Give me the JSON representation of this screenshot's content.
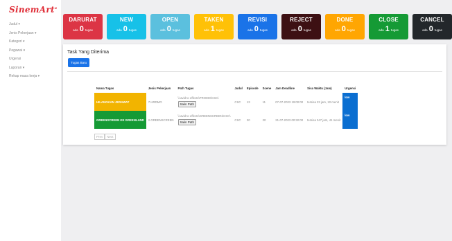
{
  "app": {
    "logo_text": "SinemArt",
    "logo_suffix": "a"
  },
  "sidebar": {
    "items": [
      {
        "label": "Judul ▾"
      },
      {
        "label": "Jenis Pekerjaan ▾"
      },
      {
        "label": "Kategori ▾"
      },
      {
        "label": "Pegawai ▾"
      },
      {
        "label": "Urgensi"
      },
      {
        "label": "Laporan ▾"
      },
      {
        "label": "Rekap masa kerja ▾"
      }
    ]
  },
  "cards": [
    {
      "title": "DARURAT",
      "prefix": "ada",
      "count": "0",
      "suffix": "tugas",
      "color": "#dc3545"
    },
    {
      "title": "NEW",
      "prefix": "ada",
      "count": "0",
      "suffix": "tugas",
      "color": "#17c1e8"
    },
    {
      "title": "OPEN",
      "prefix": "ada",
      "count": "0",
      "suffix": "tugas",
      "color": "#5bc0de"
    },
    {
      "title": "TAKEN",
      "prefix": "ada",
      "count": "1",
      "suffix": "tugas",
      "color": "#ffc107"
    },
    {
      "title": "REVISI",
      "prefix": "ada",
      "count": "0",
      "suffix": "tugas",
      "color": "#1a73e8"
    },
    {
      "title": "REJECT",
      "prefix": "ada",
      "count": "0",
      "suffix": "tugas",
      "color": "#3d1013"
    },
    {
      "title": "DONE",
      "prefix": "ada",
      "count": "0",
      "suffix": "tugas",
      "color": "#ffa602"
    },
    {
      "title": "CLOSE",
      "prefix": "ada",
      "count": "1",
      "suffix": "tugas",
      "color": "#159a35"
    },
    {
      "title": "CANCEL",
      "prefix": "ada",
      "count": "0",
      "suffix": "tugas",
      "color": "#23272b"
    }
  ],
  "panel": {
    "title": "Task Yang Diterima",
    "new_task_button": "Tugas Baru"
  },
  "table": {
    "headers": [
      "Nama Tugas",
      "Jenis Pekerjaan",
      "Path Tugas",
      "Judul",
      "Episode",
      "Scene",
      "Jam Deadline",
      "Sisa Waktu (Jam)",
      "Urgensi"
    ],
    "copy_button": "Salin Path",
    "rows": [
      {
        "name": "HILANGKAN JERAWAT",
        "name_color": "#f2b400",
        "jenis": "7.HRDMO",
        "path": "\\\\.avid to effects\\PROMO\\CSC\\",
        "judul": "CSC",
        "episode": "13",
        "scene": "11",
        "deadline": "07-07-2023 19:00:00",
        "sisa": "tersisa 23 jam, 10 menit",
        "urgensi": "low",
        "urgensi_color": "#0a6ed1"
      },
      {
        "name": "GREENSCREEN KE GREENLAND",
        "name_color": "#159a35",
        "jenis": "2.GREENSCREEN",
        "path": "\\\\.avid to effects\\GREENSCREEN\\CSC\\",
        "judul": "CSC",
        "episode": "20",
        "scene": "20",
        "deadline": "21-07-2023 00:32:00",
        "sisa": "tersisa 347 jam, 41 menit",
        "urgensi": "low",
        "urgensi_color": "#0a6ed1"
      }
    ]
  },
  "pager": {
    "prev": "Prev",
    "next": "Next"
  }
}
